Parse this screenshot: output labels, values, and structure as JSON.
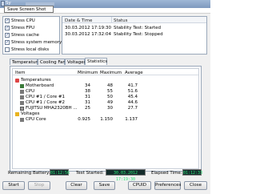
{
  "window": {
    "title": "Sy",
    "tooltip": "Save Screen Shot"
  },
  "stress": [
    {
      "label": "Stress CPU",
      "checked": true
    },
    {
      "label": "Stress FPU",
      "checked": true
    },
    {
      "label": "Stress cache",
      "checked": true
    },
    {
      "label": "Stress system memory",
      "checked": true
    },
    {
      "label": "Stress local disks",
      "checked": false
    }
  ],
  "log": {
    "headers": {
      "datetime": "Date & Time",
      "status": "Status"
    },
    "rows": [
      {
        "datetime": "30.03.2012 17:19:30",
        "status": "Stability Test: Started"
      },
      {
        "datetime": "30.03.2012 17:32:04",
        "status": "Stability Test: Stopped"
      }
    ]
  },
  "tabs": [
    "Temperatures",
    "Cooling Fans",
    "Voltages",
    "Statistics"
  ],
  "stats": {
    "headers": {
      "item": "Item",
      "min": "Minimum",
      "max": "Maximum",
      "avg": "Average"
    },
    "rows": [
      {
        "item": "Temperatures",
        "min": "",
        "max": "",
        "avg": "",
        "level": 0
      },
      {
        "item": "Motherboard",
        "min": "34",
        "max": "48",
        "avg": "41.7",
        "level": 1
      },
      {
        "item": "CPU",
        "min": "38",
        "max": "55",
        "avg": "51.6",
        "level": 1
      },
      {
        "item": "CPU #1 / Core #1",
        "min": "31",
        "max": "50",
        "avg": "45.4",
        "level": 1
      },
      {
        "item": "CPU #1 / Core #2",
        "min": "31",
        "max": "49",
        "avg": "44.6",
        "level": 1
      },
      {
        "item": "FUJITSU MHA2320BH ...",
        "min": "25",
        "max": "30",
        "avg": "27.7",
        "level": 1
      },
      {
        "item": "Voltages",
        "min": "",
        "max": "",
        "avg": "",
        "level": 0
      },
      {
        "item": "CPU Core",
        "min": "0.925",
        "max": "1.150",
        "avg": "1.137",
        "level": 1
      }
    ]
  },
  "status": {
    "battery_label": "Remaining Battery:",
    "battery_value": "01:12:56",
    "started_label": "Test Started:",
    "started_value": "30.03.2012 17:19:30",
    "elapsed_label": "Elapsed Time:",
    "elapsed_value": "01:12:33"
  },
  "buttons": {
    "start": "Start",
    "stop": "Stop",
    "clear": "Clear",
    "save": "Save",
    "cpuid": "CPUID",
    "preferences": "Preferences",
    "close": "Close"
  }
}
